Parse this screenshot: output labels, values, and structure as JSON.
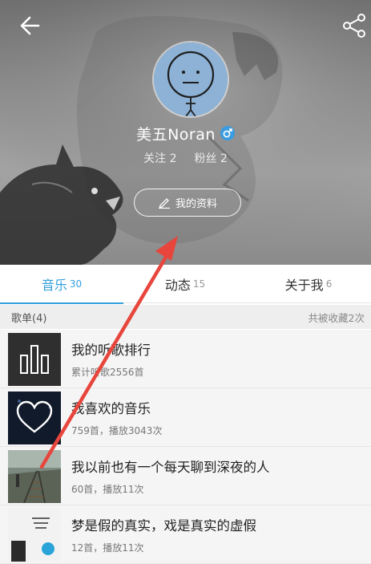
{
  "header": {
    "back_icon": "arrow-left-icon",
    "share_icon": "share-icon",
    "username": "美五Noran",
    "gender_icon": "male-icon",
    "following": "关注 2",
    "followers": "粉丝 2",
    "profile_button": "我的资料",
    "profile_button_icon": "edit-icon"
  },
  "tabs": [
    {
      "label": "音乐",
      "count": "30",
      "active": true
    },
    {
      "label": "动态",
      "count": "15",
      "active": false
    },
    {
      "label": "关于我",
      "count": "6",
      "active": false
    }
  ],
  "section": {
    "title": "歌单(4)",
    "favorited": "共被收藏2次"
  },
  "playlists": [
    {
      "title": "我的听歌排行",
      "subtitle": "累计听歌2556首",
      "icon": "bar-chart-icon"
    },
    {
      "title": "我喜欢的音乐",
      "subtitle": "759首，播放3043次",
      "icon": "heart-icon"
    },
    {
      "title": "我以前也有一个每天聊到深夜的人",
      "subtitle": "60首，播放11次",
      "icon": "railway-photo"
    },
    {
      "title": "梦是假的真实，戏是真实的虚假",
      "subtitle": "12首，播放11次",
      "icon": "poster-photo"
    }
  ],
  "colors": {
    "accent": "#31a0dc",
    "annotation_arrow": "#e8453c"
  }
}
